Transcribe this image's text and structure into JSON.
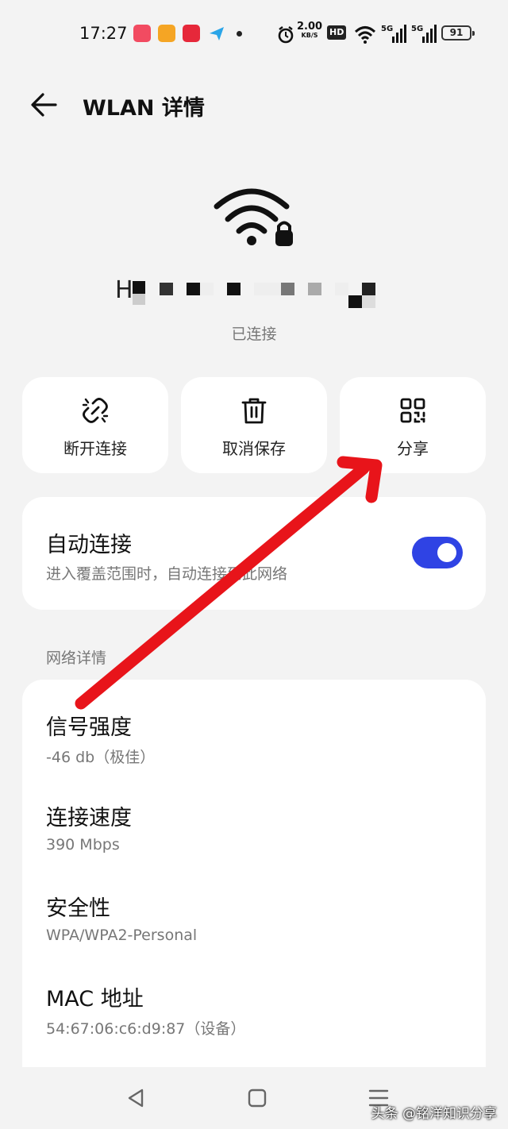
{
  "status_bar": {
    "time": "17:27",
    "speed_value": "2.00",
    "speed_unit": "KB/S",
    "hd_badge": "HD",
    "network_1": "5G",
    "network_2": "5G",
    "battery": "91"
  },
  "header": {
    "title": "WLAN 详情"
  },
  "network": {
    "ssid_visible_prefix": "H",
    "status": "已连接"
  },
  "actions": [
    {
      "label": "断开连接",
      "icon": "broken-link-icon"
    },
    {
      "label": "取消保存",
      "icon": "trash-icon"
    },
    {
      "label": "分享",
      "icon": "qr-code-icon"
    }
  ],
  "auto_connect": {
    "title": "自动连接",
    "subtitle": "进入覆盖范围时，自动连接到此网络",
    "enabled": true,
    "accent": "#2f43e4"
  },
  "details_section_label": "网络详情",
  "details": [
    {
      "title": "信号强度",
      "value": "-46 db（极佳）"
    },
    {
      "title": "连接速度",
      "value": "390 Mbps"
    },
    {
      "title": "安全性",
      "value": "WPA/WPA2-Personal"
    },
    {
      "title": "MAC 地址",
      "value": "54:67:06:c6:d9:87（设备）"
    }
  ],
  "watermark": "头条 @铭洋知识分享",
  "annotation_color": "#e8141a"
}
